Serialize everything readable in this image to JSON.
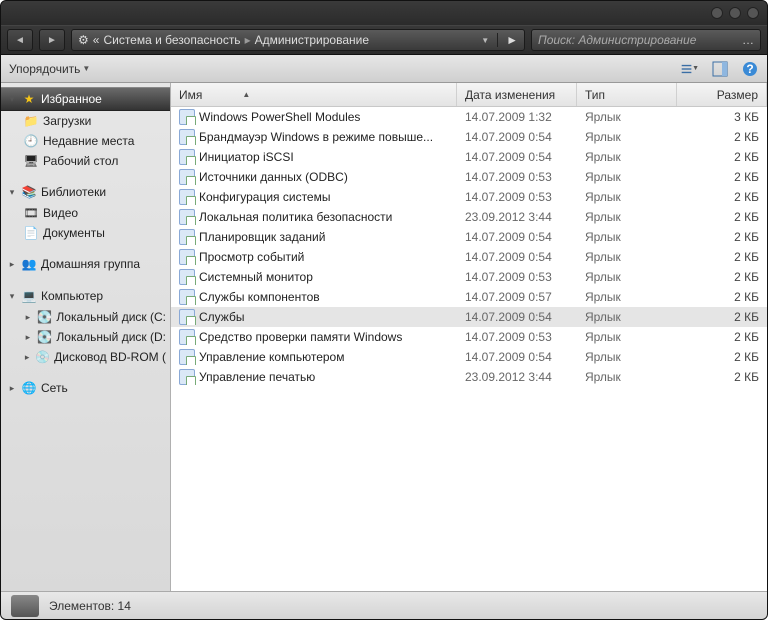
{
  "breadcrumb": {
    "pre": "«",
    "seg1": "Система и безопасность",
    "seg2": "Администрирование"
  },
  "search": {
    "placeholder": "Поиск: Администрирование"
  },
  "toolbar": {
    "organize": "Упорядочить"
  },
  "sidebar": {
    "favorites": {
      "label": "Избранное",
      "items": [
        {
          "label": "Загрузки"
        },
        {
          "label": "Недавние места"
        },
        {
          "label": "Рабочий стол"
        }
      ]
    },
    "libraries": {
      "label": "Библиотеки",
      "items": [
        {
          "label": "Видео"
        },
        {
          "label": "Документы"
        }
      ]
    },
    "homegroup": {
      "label": "Домашняя группа"
    },
    "computer": {
      "label": "Компьютер",
      "items": [
        {
          "label": "Локальный диск (C:"
        },
        {
          "label": "Локальный диск (D:"
        },
        {
          "label": "Дисковод BD-ROM ("
        }
      ]
    },
    "network": {
      "label": "Сеть"
    }
  },
  "columns": {
    "name": "Имя",
    "date": "Дата изменения",
    "type": "Тип",
    "size": "Размер"
  },
  "rows": [
    {
      "name": "Windows PowerShell Modules",
      "date": "14.07.2009 1:32",
      "type": "Ярлык",
      "size": "3 КБ"
    },
    {
      "name": "Брандмауэр Windows в режиме повыше...",
      "date": "14.07.2009 0:54",
      "type": "Ярлык",
      "size": "2 КБ"
    },
    {
      "name": "Инициатор iSCSI",
      "date": "14.07.2009 0:54",
      "type": "Ярлык",
      "size": "2 КБ"
    },
    {
      "name": "Источники данных (ODBC)",
      "date": "14.07.2009 0:53",
      "type": "Ярлык",
      "size": "2 КБ"
    },
    {
      "name": "Конфигурация системы",
      "date": "14.07.2009 0:53",
      "type": "Ярлык",
      "size": "2 КБ"
    },
    {
      "name": "Локальная политика безопасности",
      "date": "23.09.2012 3:44",
      "type": "Ярлык",
      "size": "2 КБ"
    },
    {
      "name": "Планировщик заданий",
      "date": "14.07.2009 0:54",
      "type": "Ярлык",
      "size": "2 КБ"
    },
    {
      "name": "Просмотр событий",
      "date": "14.07.2009 0:54",
      "type": "Ярлык",
      "size": "2 КБ"
    },
    {
      "name": "Системный монитор",
      "date": "14.07.2009 0:53",
      "type": "Ярлык",
      "size": "2 КБ"
    },
    {
      "name": "Службы компонентов",
      "date": "14.07.2009 0:57",
      "type": "Ярлык",
      "size": "2 КБ"
    },
    {
      "name": "Службы",
      "date": "14.07.2009 0:54",
      "type": "Ярлык",
      "size": "2 КБ",
      "selected": true
    },
    {
      "name": "Средство проверки памяти Windows",
      "date": "14.07.2009 0:53",
      "type": "Ярлык",
      "size": "2 КБ"
    },
    {
      "name": "Управление компьютером",
      "date": "14.07.2009 0:54",
      "type": "Ярлык",
      "size": "2 КБ"
    },
    {
      "name": "Управление печатью",
      "date": "23.09.2012 3:44",
      "type": "Ярлык",
      "size": "2 КБ"
    }
  ],
  "status": {
    "count_label": "Элементов: 14"
  }
}
